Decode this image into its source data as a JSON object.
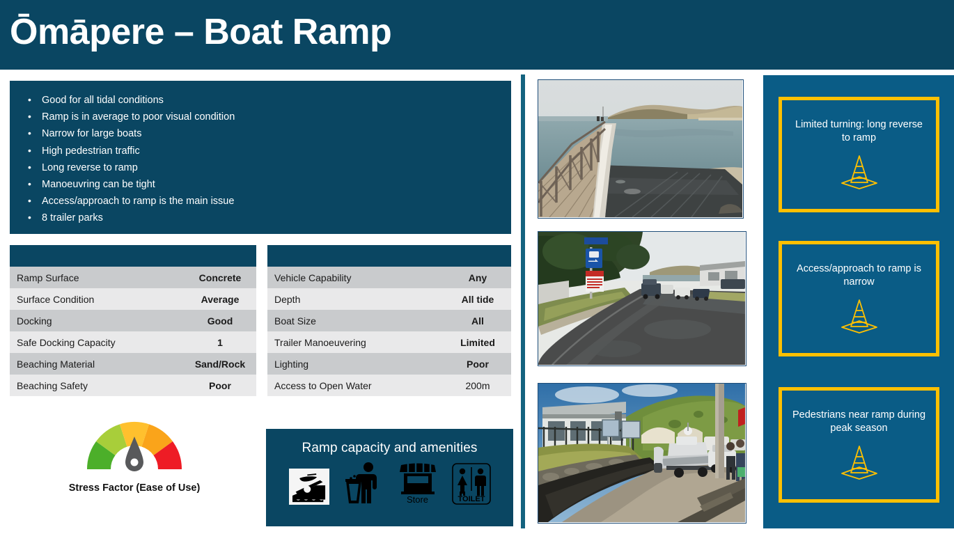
{
  "header": {
    "title": "Ōmāpere – Boat Ramp",
    "bg_color": "#0A4662"
  },
  "bullets": {
    "items": [
      "Good for all tidal conditions",
      "Ramp is in average to poor visual condition",
      "Narrow for large boats",
      "High pedestrian traffic",
      "Long reverse to ramp",
      "Manoeuvring can be tight",
      "Access/approach to ramp is the main issue",
      "8 trailer parks"
    ]
  },
  "table_left": {
    "header": "",
    "rows": [
      {
        "key": "Ramp Surface",
        "value": "Concrete",
        "color": "#1a1a1a",
        "bold": true
      },
      {
        "key": "Surface Condition",
        "value": "Average",
        "color": "#FFA500",
        "bold": true
      },
      {
        "key": "Docking",
        "value": "Good",
        "color": "#FF0000",
        "bold": true
      },
      {
        "key": "Safe Docking Capacity",
        "value": "1",
        "color": "#1a1a1a",
        "bold": true
      },
      {
        "key": "Beaching Material",
        "value": "Sand/Rock",
        "color": "#1a1a1a",
        "bold": true
      },
      {
        "key": "Beaching Safety",
        "value": "Poor",
        "color": "#FF0000",
        "bold": true
      }
    ]
  },
  "table_right": {
    "header": "",
    "rows": [
      {
        "key": "Vehicle Capability",
        "value": "Any",
        "color": "#00A83F",
        "bold": true
      },
      {
        "key": "Depth",
        "value": "All tide",
        "color": "#00A83F",
        "bold": true
      },
      {
        "key": "Boat Size",
        "value": "All",
        "color": "#00A83F",
        "bold": true
      },
      {
        "key": "Trailer Manoeuvering",
        "value": "Limited",
        "color": "#FFA500",
        "bold": true
      },
      {
        "key": "Lighting",
        "value": "Poor",
        "color": "#FF0000",
        "bold": true
      },
      {
        "key": "Access to Open Water",
        "value": "200m",
        "color": "#1a1a1a",
        "bold": false
      }
    ]
  },
  "gauge": {
    "label": "Stress Factor (Ease of Use)",
    "needle_position": "centre",
    "segments": [
      "#4CAF2A",
      "#A8CE3A",
      "#FFC02E",
      "#FAA41A",
      "#EE1C25"
    ]
  },
  "amenities": {
    "title": "Ramp capacity and amenities",
    "items": [
      {
        "icon": "boat-ramp-icon",
        "caption": ""
      },
      {
        "icon": "rubbish-bin-icon",
        "caption": ""
      },
      {
        "icon": "store-icon",
        "caption": "Store"
      },
      {
        "icon": "toilet-icon",
        "caption": "TOILET"
      }
    ]
  },
  "photos": [
    {
      "name": "photo-jetty-and-ramp",
      "alt": "Wooden jetty beside concrete boat ramp at harbour with sand dunes"
    },
    {
      "name": "photo-access-road",
      "alt": "Sealed access road with signage leading down to the water"
    },
    {
      "name": "photo-boat-launching",
      "alt": "Boat on trailer being launched down the ramp beside houses and hill"
    }
  ],
  "risks": {
    "panel_color": "#0A5C86",
    "border_color": "#FFC000",
    "items": [
      {
        "text": "Limited turning: long reverse to ramp",
        "icon": "traffic-cone-icon"
      },
      {
        "text": "Access/approach to ramp is narrow",
        "icon": "traffic-cone-icon"
      },
      {
        "text": "Pedestrians near ramp during peak season",
        "icon": "traffic-cone-icon"
      }
    ]
  }
}
